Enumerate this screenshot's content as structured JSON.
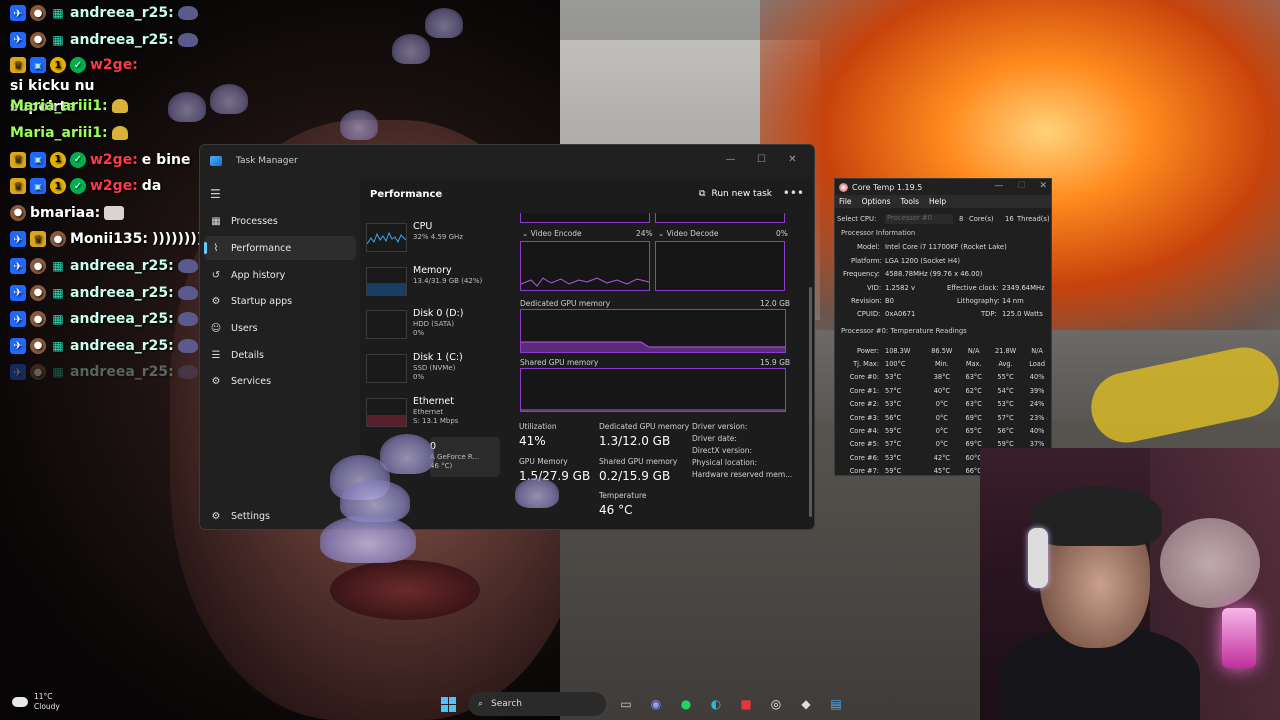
{
  "chat": {
    "lines": [
      {
        "user": "andreea_r25:",
        "msg": ""
      },
      {
        "user": "andreea_r25:",
        "msg": ""
      },
      {
        "user": "w2ge:",
        "msg": "si kicku nu",
        "msg2": "supoirta"
      },
      {
        "user": "Maria_ariii1:",
        "msg": ""
      },
      {
        "user": "Maria_ariii1:",
        "msg": ""
      },
      {
        "user": "w2ge:",
        "msg": "e bine"
      },
      {
        "user": "w2ge:",
        "msg": "da"
      },
      {
        "user": "bmariaa:",
        "msg": ""
      },
      {
        "user": "Monii135:",
        "msg": "))))))))"
      },
      {
        "user": "andreea_r25:",
        "msg": ""
      },
      {
        "user": "andreea_r25:",
        "msg": ""
      },
      {
        "user": "andreea_r25:",
        "msg": ""
      },
      {
        "user": "andreea_r25:",
        "msg": ""
      },
      {
        "user": "andreea_r25:",
        "msg": ""
      }
    ],
    "badge_one": "1"
  },
  "task_manager": {
    "title": "Task Manager",
    "nav": {
      "processes": "Processes",
      "performance": "Performance",
      "app_history": "App history",
      "startup_apps": "Startup apps",
      "users": "Users",
      "details": "Details",
      "services": "Services",
      "settings": "Settings"
    },
    "heading": "Performance",
    "run_new_task": "Run new task",
    "resources": [
      {
        "name": "CPU",
        "sub1": "32% 4.59 GHz",
        "sub2": ""
      },
      {
        "name": "Memory",
        "sub1": "13.4/31.9 GB (42%)",
        "sub2": ""
      },
      {
        "name": "Disk 0 (D:)",
        "sub1": "HDD (SATA)",
        "sub2": "0%"
      },
      {
        "name": "Disk 1 (C:)",
        "sub1": "SSD (NVMe)",
        "sub2": "0%"
      },
      {
        "name": "Ethernet",
        "sub1": "Ethernet",
        "sub2": "S: 13.1 Mbps"
      },
      {
        "name": "0",
        "sub1": "A GeForce R...",
        "sub2": "46 °C)"
      }
    ],
    "gpu": {
      "video_encode_label": "Video Encode",
      "video_encode_pct": "24%",
      "video_decode_label": "Video Decode",
      "video_decode_pct": "0%",
      "dedicated_label": "Dedicated GPU memory",
      "dedicated_max": "12.0 GB",
      "shared_label": "Shared GPU memory",
      "shared_max": "15.9 GB",
      "utilization_label": "Utilization",
      "utilization_val": "41%",
      "dedicated_stat_label": "Dedicated GPU memory",
      "dedicated_stat_val": "1.3/12.0 GB",
      "gpu_memory_label": "GPU Memory",
      "gpu_memory_val": "1.5/27.9 GB",
      "shared_stat_label": "Shared GPU memory",
      "shared_stat_val": "0.2/15.9 GB",
      "temperature_label": "Temperature",
      "temperature_val": "46 °C",
      "driver_version": "Driver version:",
      "driver_date": "Driver date:",
      "directx": "DirectX version:",
      "physical_location": "Physical location:",
      "hw_reserved": "Hardware reserved mem..."
    }
  },
  "core_temp": {
    "title": "Core Temp 1.19.5",
    "menu": {
      "file": "File",
      "options": "Options",
      "tools": "Tools",
      "help": "Help"
    },
    "select_cpu": "Select CPU:",
    "processor_select": "Processor #0",
    "cores": "8",
    "cores_label": "Core(s)",
    "threads": "16",
    "threads_label": "Thread(s)",
    "proc_info": "Processor Information",
    "model_label": "Model:",
    "model": "Intel Core i7 11700KF (Rocket Lake)",
    "platform_label": "Platform:",
    "platform": "LGA 1200 (Socket H4)",
    "frequency_label": "Frequency:",
    "frequency": "4588.78MHz (99.76 x 46.00)",
    "vid_label": "VID:",
    "vid": "1.2582 v",
    "eff_clock_label": "Effective clock:",
    "eff_clock": "2349.64MHz",
    "revision_label": "Revision:",
    "revision": "B0",
    "lithography_label": "Lithography:",
    "lithography": "14 nm",
    "cpuid_label": "CPUID:",
    "cpuid": "0xA0671",
    "tdp_label": "TDP:",
    "tdp": "125.0 Watts",
    "temp_heading": "Processor #0: Temperature Readings",
    "power_label": "Power:",
    "power": [
      "108.3W",
      "86.5W",
      "N/A",
      "21.8W",
      "N/A"
    ],
    "tjmax_label": "Tj. Max:",
    "tjmax": "100°C",
    "cols": [
      "Min.",
      "Max.",
      "Avg.",
      "Load"
    ],
    "cores_rows": [
      {
        "label": "Core #0:",
        "cur": "53°C",
        "min": "38°C",
        "max": "63°C",
        "avg": "55°C",
        "load": "40%"
      },
      {
        "label": "Core #1:",
        "cur": "57°C",
        "min": "40°C",
        "max": "62°C",
        "avg": "54°C",
        "load": "39%"
      },
      {
        "label": "Core #2:",
        "cur": "53°C",
        "min": "0°C",
        "max": "63°C",
        "avg": "53°C",
        "load": "24%"
      },
      {
        "label": "Core #3:",
        "cur": "56°C",
        "min": "0°C",
        "max": "69°C",
        "avg": "57°C",
        "load": "23%"
      },
      {
        "label": "Core #4:",
        "cur": "59°C",
        "min": "0°C",
        "max": "65°C",
        "avg": "56°C",
        "load": "40%"
      },
      {
        "label": "Core #5:",
        "cur": "57°C",
        "min": "0°C",
        "max": "69°C",
        "avg": "59°C",
        "load": "37%"
      },
      {
        "label": "Core #6:",
        "cur": "53°C",
        "min": "42°C",
        "max": "60°C",
        "avg": "",
        "load": ""
      },
      {
        "label": "Core #7:",
        "cur": "59°C",
        "min": "45°C",
        "max": "66°C",
        "avg": "",
        "load": ""
      }
    ]
  },
  "taskbar": {
    "weather_temp": "11°C",
    "weather_desc": "Cloudy",
    "search": "Search"
  },
  "colors": {
    "accent": "#60cdff",
    "gpu_graph": "#8d3ccc",
    "chat_red": "#ff3a47",
    "chat_mint": "#4ff0b0"
  }
}
